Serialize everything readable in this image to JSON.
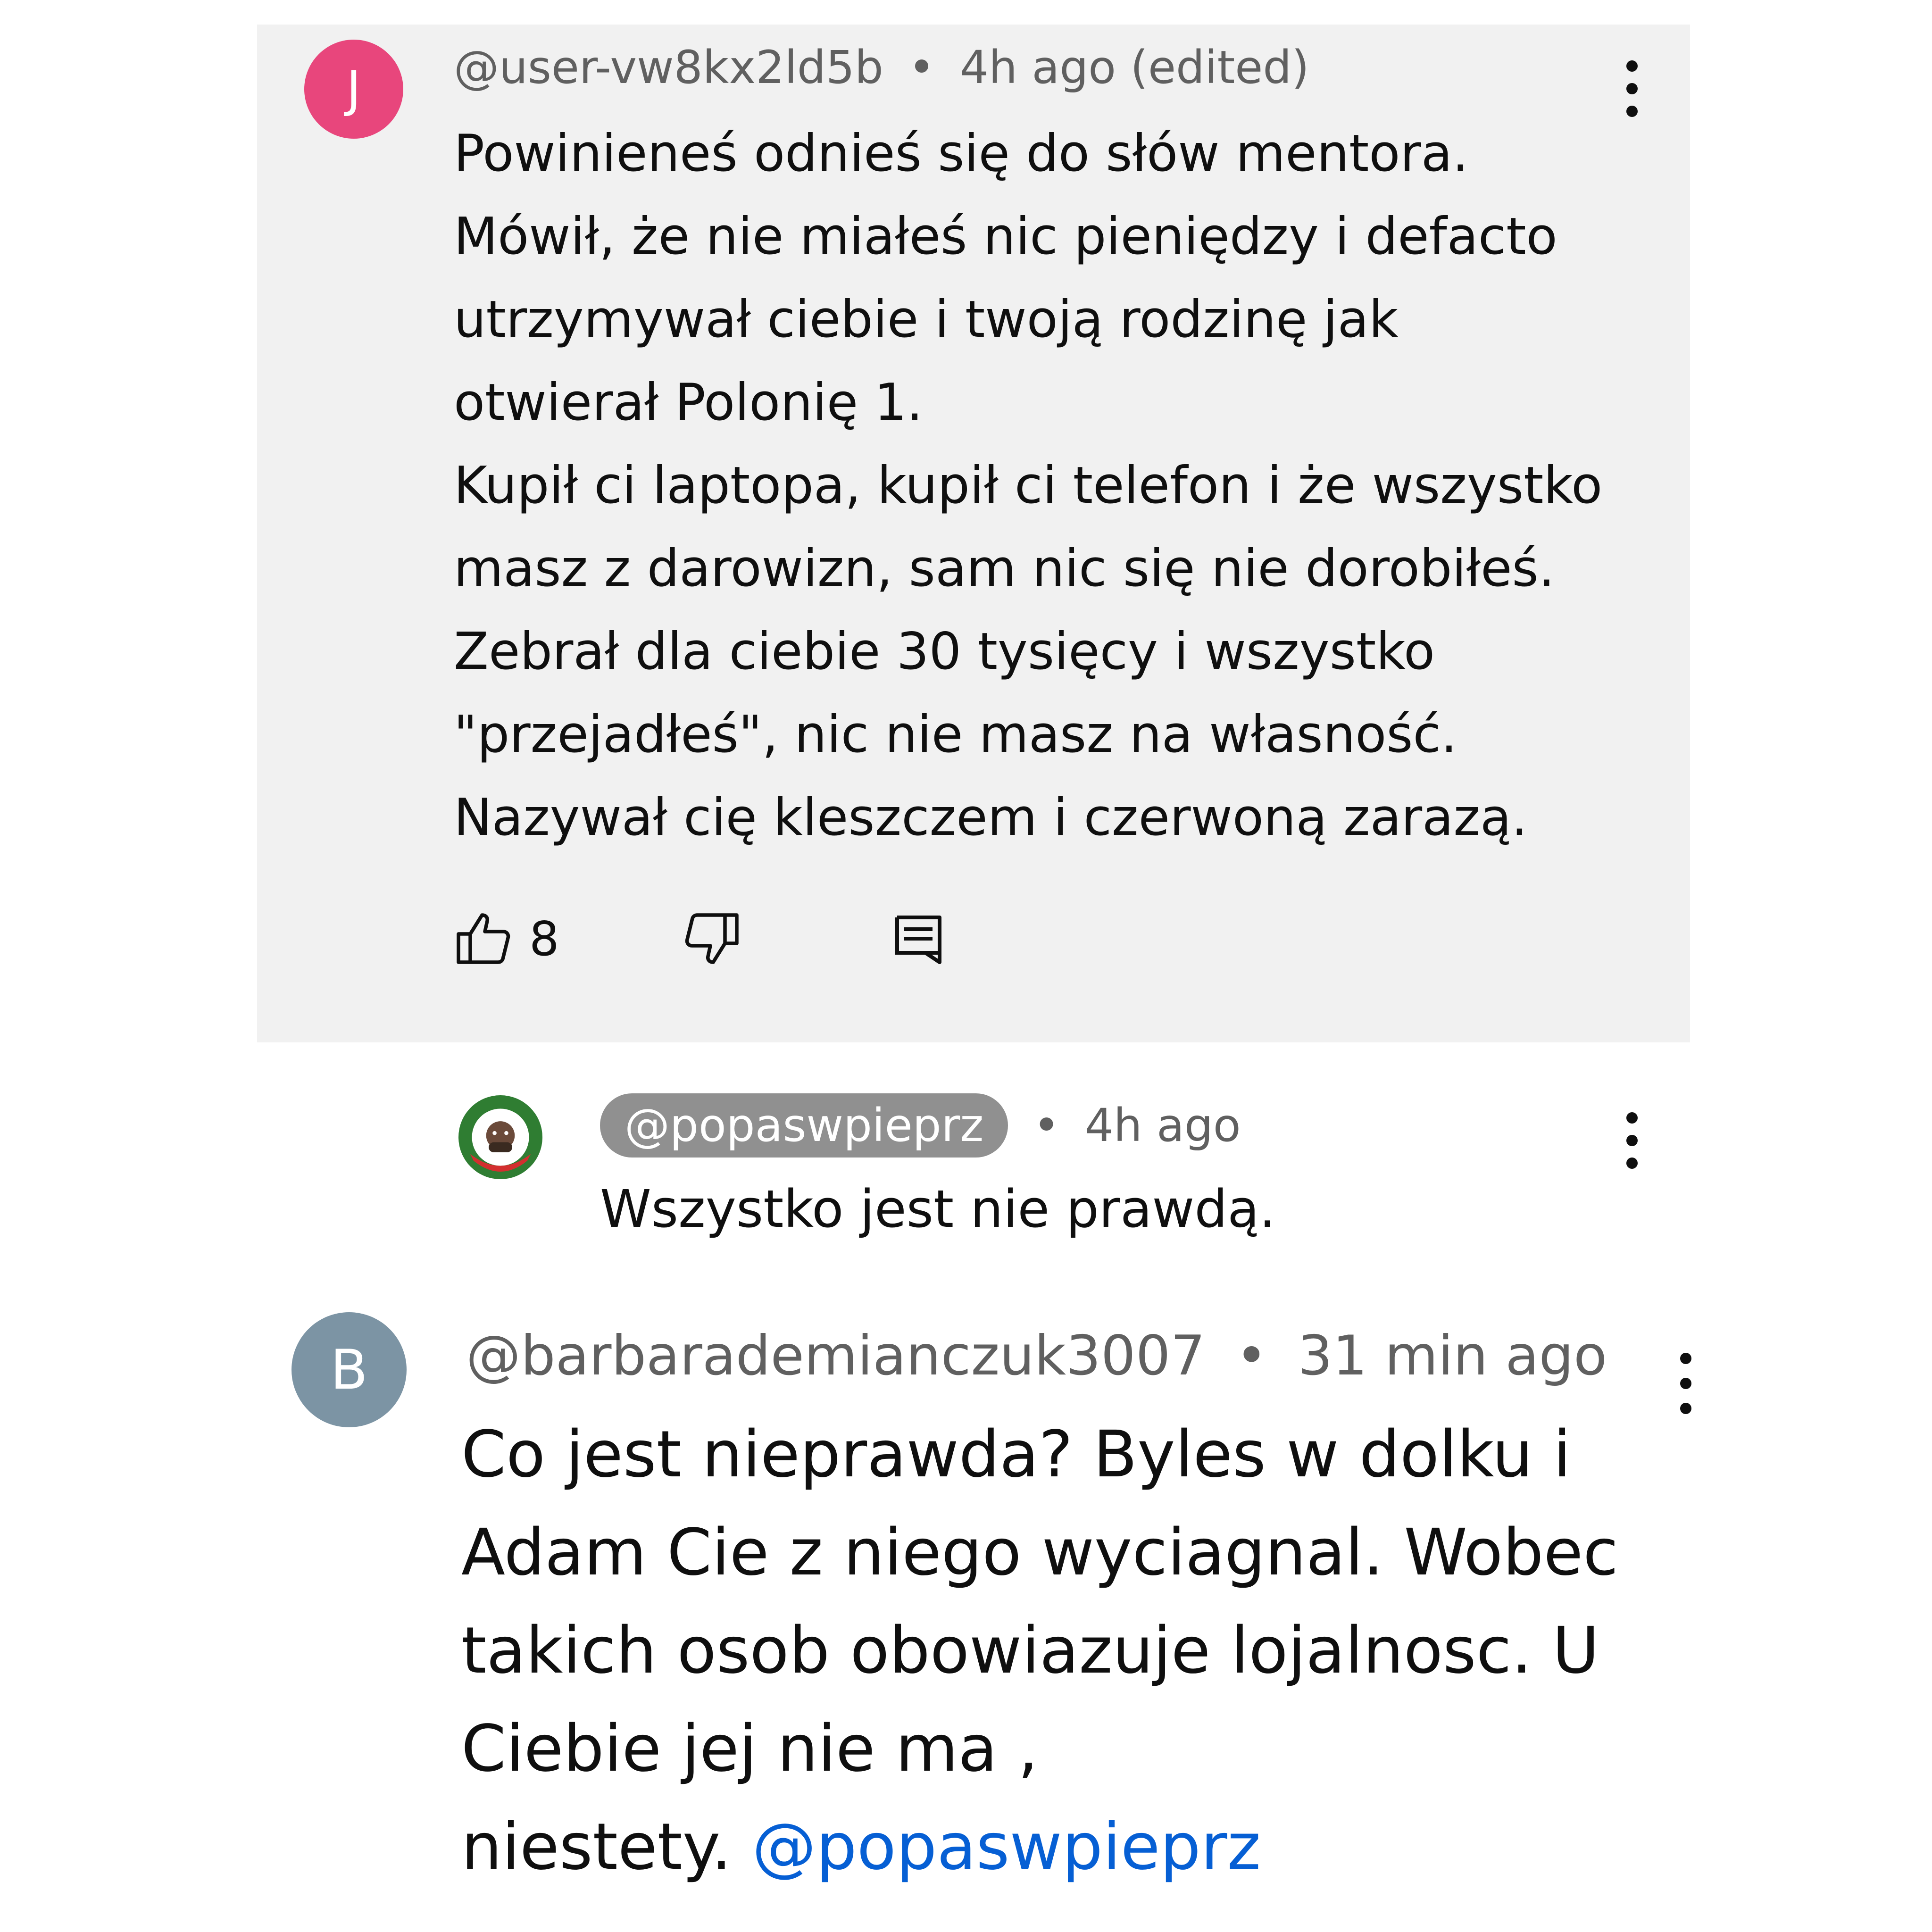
{
  "comments": {
    "top": {
      "avatar_letter": "J",
      "avatar_color": "#e8467c",
      "handle": "@user-vw8kx2ld5b",
      "time": "4h ago (edited)",
      "lines": [
        "Powinieneś odnieś się do słów mentora.",
        "Mówił, że nie miałeś nic pieniędzy i defacto",
        "utrzymywał ciebie i twoją rodzinę jak",
        "otwierał Polonię 1.",
        "Kupił ci laptopa, kupił ci telefon i że wszystko",
        "masz z darowizn, sam nic się nie dorobiłeś.",
        "Zebrał dla ciebie 30 tysięcy i wszystko",
        "\"przejadłeś\", nic nie masz na własność.",
        "Nazywał cię kleszczem i czerwoną zarazą."
      ],
      "like_count": "8",
      "background": "#f1f1f1"
    },
    "reply": {
      "avatar_icon": "channel-logo-icon",
      "handle": "@popaswpieprz",
      "time": "4h ago",
      "text": "Wszystko jest nie prawdą."
    },
    "latest": {
      "avatar_letter": "B",
      "avatar_color": "#7c94a4",
      "handle": "@barbarademianczuk3007",
      "time": "31 min ago",
      "text_lines": [
        "Co jest nieprawda? Byles w dolku i",
        "Adam Cie z niego wyciagnal. Wobec",
        "takich osob obowiazuje lojalnosc. U",
        "Ciebie jej nie ma ,"
      ],
      "last_line_prefix": "niestety.",
      "mention": "@popaswpieprz",
      "mention_color": "#065fd4"
    }
  },
  "icons": {
    "like": "thumb-up-icon",
    "dislike": "thumb-down-icon",
    "reply": "comment-reply-icon",
    "menu": "more-vert-icon"
  }
}
